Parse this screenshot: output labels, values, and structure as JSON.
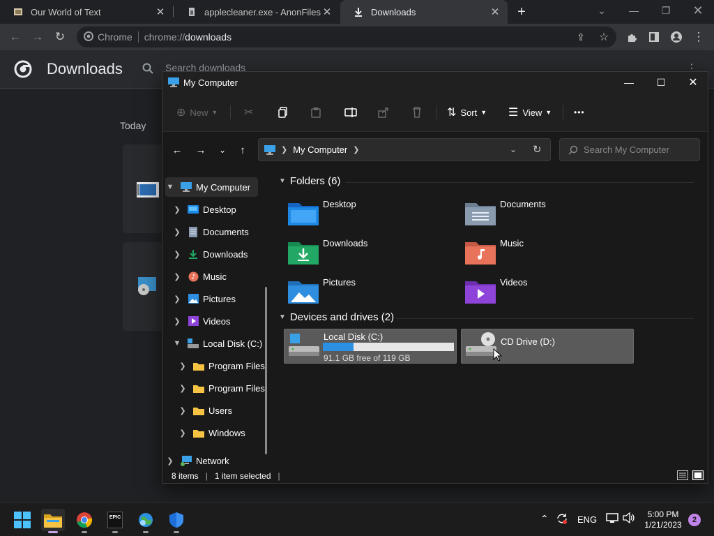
{
  "browser": {
    "tabs": [
      {
        "title": "Our World of Text",
        "active": false
      },
      {
        "title": "applecleaner.exe - AnonFiles",
        "active": false
      },
      {
        "title": "Downloads",
        "active": true
      }
    ],
    "new_tab": "+",
    "omnibox": {
      "chip": "Chrome",
      "scheme": "chrome://",
      "host": "downloads"
    }
  },
  "downloads_page": {
    "title": "Downloads",
    "search_placeholder": "Search downloads",
    "section_today": "Today"
  },
  "explorer": {
    "title": "My Computer",
    "commands": {
      "new": "New",
      "sort": "Sort",
      "view": "View",
      "more": "•••"
    },
    "breadcrumb": [
      "My Computer"
    ],
    "search_placeholder": "Search My Computer",
    "tree": [
      {
        "label": "My Computer",
        "icon": "computer-icon",
        "selected": true
      },
      {
        "label": "Desktop",
        "icon": "desktop-icon"
      },
      {
        "label": "Documents",
        "icon": "documents-icon"
      },
      {
        "label": "Downloads",
        "icon": "downloads-icon"
      },
      {
        "label": "Music",
        "icon": "music-icon"
      },
      {
        "label": "Pictures",
        "icon": "pictures-icon"
      },
      {
        "label": "Videos",
        "icon": "videos-icon"
      },
      {
        "label": "Local Disk (C:)",
        "icon": "drive-icon"
      },
      {
        "label": "Program Files",
        "icon": "folder-icon"
      },
      {
        "label": "Program Files",
        "icon": "folder-icon"
      },
      {
        "label": "Users",
        "icon": "folder-icon"
      },
      {
        "label": "Windows",
        "icon": "folder-icon"
      },
      {
        "label": "Network",
        "icon": "network-icon"
      }
    ],
    "folders_header": "Folders (6)",
    "folders": [
      {
        "name": "Desktop",
        "color": "#1e88e5"
      },
      {
        "name": "Documents",
        "color": "#8a9bb0"
      },
      {
        "name": "Downloads",
        "color": "#22a864"
      },
      {
        "name": "Music",
        "color": "#e8735a"
      },
      {
        "name": "Pictures",
        "color": "#2f8ee0"
      },
      {
        "name": "Videos",
        "color": "#8e44d8"
      }
    ],
    "drives_header": "Devices and drives (2)",
    "drives": [
      {
        "name": "Local Disk (C:)",
        "free": "91.1 GB free of 119 GB",
        "used_fraction": 0.234
      },
      {
        "name": "CD Drive (D:)"
      }
    ],
    "status": {
      "items": "8 items",
      "selected": "1 item selected"
    }
  },
  "taskbar": {
    "language": "ENG",
    "time": "5:00 PM",
    "date": "1/21/2023",
    "notifications": "2",
    "epic_label": "EPIC"
  }
}
